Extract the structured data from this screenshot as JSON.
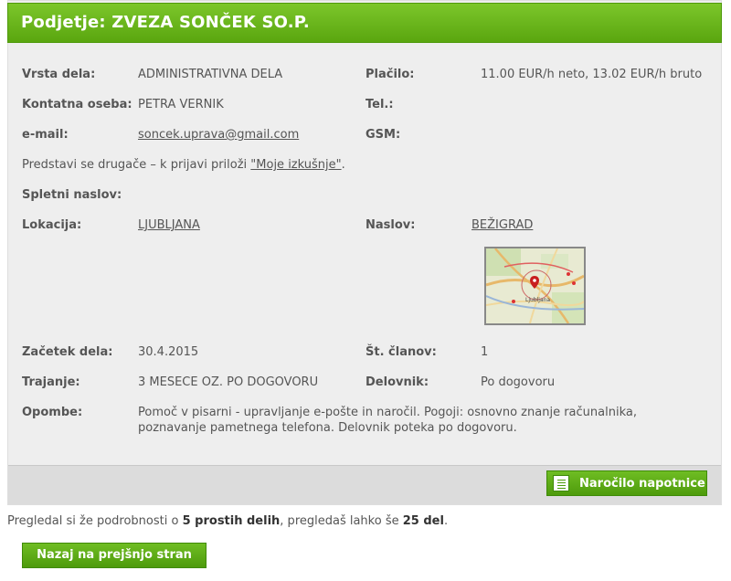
{
  "header": {
    "title": "Podjetje: ZVEZA SONČEK SO.P."
  },
  "details": {
    "vrsta_label": "Vrsta dela:",
    "vrsta_value": "ADMINISTRATIVNA DELA",
    "placilo_label": "Plačilo:",
    "placilo_value": "11.00 EUR/h neto, 13.02 EUR/h bruto",
    "kontakt_label": "Kontatna oseba:",
    "kontakt_value": "PETRA VERNIK",
    "tel_label": "Tel.:",
    "email_label": "e-mail:",
    "email_value": "soncek.uprava@gmail.com",
    "gsm_label": "GSM:",
    "predstavi_text": "Predstavi se drugače – k prijavi priloži ",
    "predstavi_link": "\"Moje izkušnje\"",
    "predstavi_end": ".",
    "spletni_label": "Spletni naslov:",
    "lokacija_label": "Lokacija:",
    "lokacija_value": "LJUBLJANA",
    "naslov_label": "Naslov:",
    "naslov_value": "BEŽIGRAD",
    "zacetek_label": "Začetek dela:",
    "zacetek_value": "30.4.2015",
    "clanov_label": "Št. članov:",
    "clanov_value": "1",
    "trajanje_label": "Trajanje:",
    "trajanje_value": "3 MESECE OZ. PO DOGOVORU",
    "delovnik_label": "Delovnik:",
    "delovnik_value": "Po dogovoru",
    "opombe_label": "Opombe:",
    "opombe_line1": "Pomoč v pisarni - upravljanje e-pošte in naročil. Pogoji: osnovno znanje računalnika,",
    "opombe_line2": "poznavanje pametnega telefona. Delovnik poteka po dogovoru."
  },
  "map": {
    "city_label": "Ljubljana",
    "icon": "map-marker-icon"
  },
  "actions": {
    "order_label": "Naročilo napotnice",
    "back_label": "Nazaj na prejšnjo stran"
  },
  "info": {
    "part1": "Pregledal si že podrobnosti o ",
    "count_viewed": "5 prostih delih",
    "part2": ", pregledaš lahko še ",
    "count_left": "25 del",
    "part3": "."
  },
  "colors": {
    "accent": "#5aa60f",
    "panel": "#eeeeee"
  }
}
